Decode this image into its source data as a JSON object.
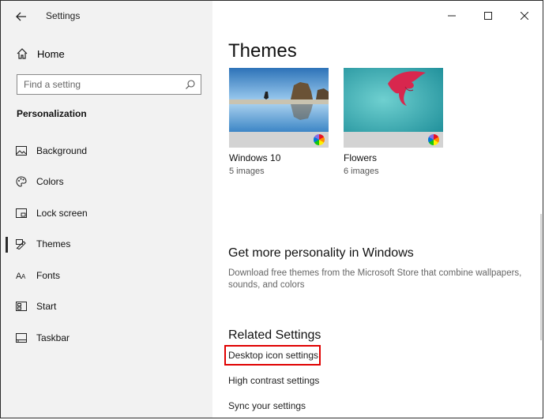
{
  "window": {
    "title": "Settings"
  },
  "sidebar": {
    "home_label": "Home",
    "search_placeholder": "Find a setting",
    "section_title": "Personalization",
    "items": [
      {
        "label": "Background",
        "icon": "image-icon"
      },
      {
        "label": "Colors",
        "icon": "palette-icon"
      },
      {
        "label": "Lock screen",
        "icon": "lock-screen-icon"
      },
      {
        "label": "Themes",
        "icon": "themes-icon",
        "active": true
      },
      {
        "label": "Fonts",
        "icon": "fonts-icon"
      },
      {
        "label": "Start",
        "icon": "start-icon"
      },
      {
        "label": "Taskbar",
        "icon": "taskbar-icon"
      }
    ]
  },
  "main": {
    "themes_heading": "Themes",
    "themes": [
      {
        "name": "Windows 10",
        "count": "5 images"
      },
      {
        "name": "Flowers",
        "count": "6 images"
      }
    ],
    "personality_heading": "Get more personality in Windows",
    "personality_desc": "Download free themes from the Microsoft Store that combine wallpapers, sounds, and colors",
    "related_heading": "Related Settings",
    "related_links": [
      "Desktop icon settings",
      "High contrast settings",
      "Sync your settings"
    ]
  },
  "colors": {
    "sidebar_bg": "#f2f2f2",
    "highlight": "#e00000"
  }
}
